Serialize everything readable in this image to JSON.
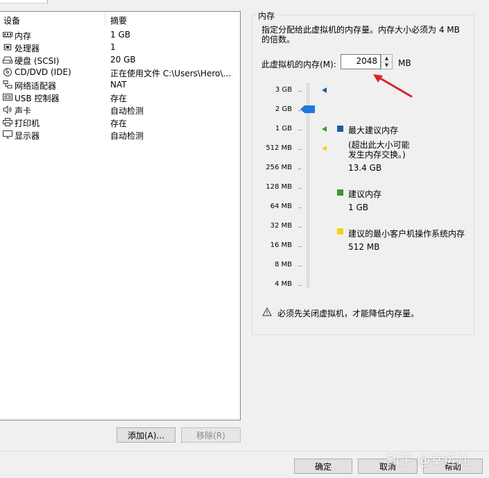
{
  "devices": {
    "columns": {
      "device": "设备",
      "summary": "摘要"
    },
    "rows": [
      {
        "name": "内存",
        "value": "1 GB",
        "icon": "memory-icon"
      },
      {
        "name": "处理器",
        "value": "1",
        "icon": "processor-icon"
      },
      {
        "name": "硬盘 (SCSI)",
        "value": "20 GB",
        "icon": "hard-disk-icon"
      },
      {
        "name": "CD/DVD (IDE)",
        "value": "正在使用文件 C:\\Users\\Hero\\D...",
        "icon": "cd-dvd-icon"
      },
      {
        "name": "网络适配器",
        "value": "NAT",
        "icon": "network-adapter-icon"
      },
      {
        "name": "USB 控制器",
        "value": "存在",
        "icon": "usb-controller-icon"
      },
      {
        "name": "声卡",
        "value": "自动检测",
        "icon": "sound-card-icon"
      },
      {
        "name": "打印机",
        "value": "存在",
        "icon": "printer-icon"
      },
      {
        "name": "显示器",
        "value": "自动检测",
        "icon": "display-icon"
      }
    ],
    "add_button": "添加(A)...",
    "remove_button": "移除(R)"
  },
  "memory": {
    "group_title": "内存",
    "description": "指定分配给此虚拟机的内存量。内存大小必须为 4 MB 的倍数。",
    "field_label": "此虚拟机的内存(M):",
    "value": "2048",
    "unit": "MB",
    "slider": {
      "ticks": [
        "3 GB",
        "2 GB",
        "1 GB",
        "512 MB",
        "256 MB",
        "128 MB",
        "64 MB",
        "32 MB",
        "16 MB",
        "8 MB",
        "4 MB"
      ],
      "selected": "2 GB"
    },
    "legend": {
      "max_title": "最大建议内存",
      "max_note_1": "(超出此大小可能",
      "max_note_2": "发生内存交换。)",
      "max_value": "13.4 GB",
      "rec_title": "建议内存",
      "rec_value": "1 GB",
      "min_title": "建议的最小客户机操作系统内存",
      "min_value": "512 MB"
    },
    "warning": "必须先关闭虚拟机，才能降低内存量。"
  },
  "colors": {
    "max": "#1e5aa8",
    "recommended": "#3a9a2c",
    "minimum": "#f2d21a",
    "slider_thumb": "#1e7ad6",
    "annotation_arrow": "#d8242a"
  },
  "footer": {
    "ok": "确定",
    "cancel": "取消",
    "help": "帮助"
  },
  "watermark": "知乎 @幸运儿"
}
